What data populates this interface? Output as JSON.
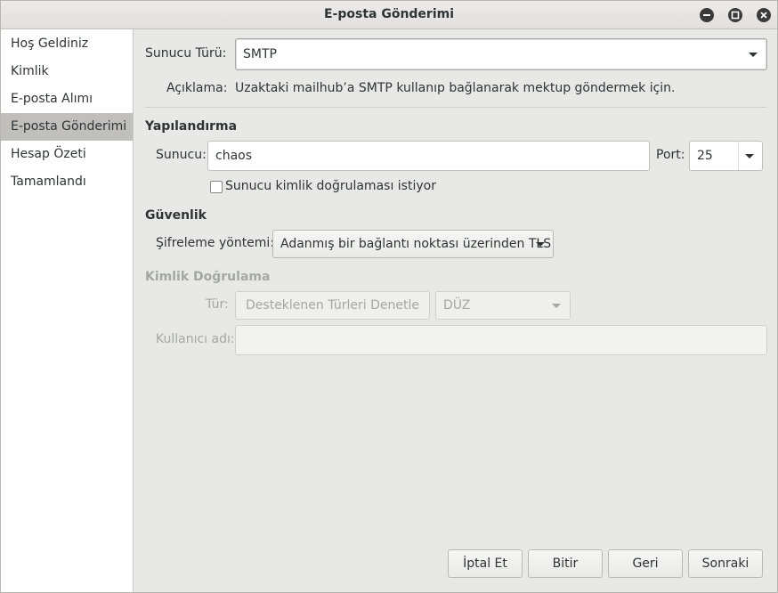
{
  "window": {
    "title": "E-posta Gönderimi",
    "controls": [
      "minimize-icon",
      "maximize-icon",
      "close-icon"
    ]
  },
  "sidebar": {
    "items": [
      {
        "label": "Hoş Geldiniz",
        "active": false
      },
      {
        "label": "Kimlik",
        "active": false
      },
      {
        "label": "E-posta Alımı",
        "active": false
      },
      {
        "label": "E-posta Gönderimi",
        "active": true
      },
      {
        "label": "Hesap Özeti",
        "active": false
      },
      {
        "label": "Tamamlandı",
        "active": false
      }
    ]
  },
  "server_type": {
    "label": "Sunucu Türü:",
    "value": "SMTP",
    "description_label": "Açıklama:",
    "description": "Uzaktaki mailhub’a SMTP kullanıp bağlanarak mektup göndermek için."
  },
  "configuration": {
    "heading": "Yapılandırma",
    "server_label": "Sunucu:",
    "server_value": "chaos",
    "port_label": "Port:",
    "port_value": "25",
    "auth_required_label": "Sunucu kimlik doğrulaması istiyor",
    "auth_required_checked": false
  },
  "security": {
    "heading": "Güvenlik",
    "encryption_label": "Şifreleme yöntemi:",
    "encryption_value": "Adanmış bir bağlantı noktası üzerinden TLS"
  },
  "authentication": {
    "heading": "Kimlik Doğrulama",
    "type_label": "Tür:",
    "check_button": "Desteklenen Türleri Denetle",
    "type_value": "DÜZ",
    "username_label": "Kullanıcı adı:",
    "username_value": ""
  },
  "footer": {
    "cancel": "İptal Et",
    "finish": "Bitir",
    "back": "Geri",
    "next": "Sonraki"
  },
  "colors": {
    "sidebar_active": "#c0bfbc",
    "window_bg": "#e8e8e7",
    "disabled_text": "#a5a7a2"
  }
}
